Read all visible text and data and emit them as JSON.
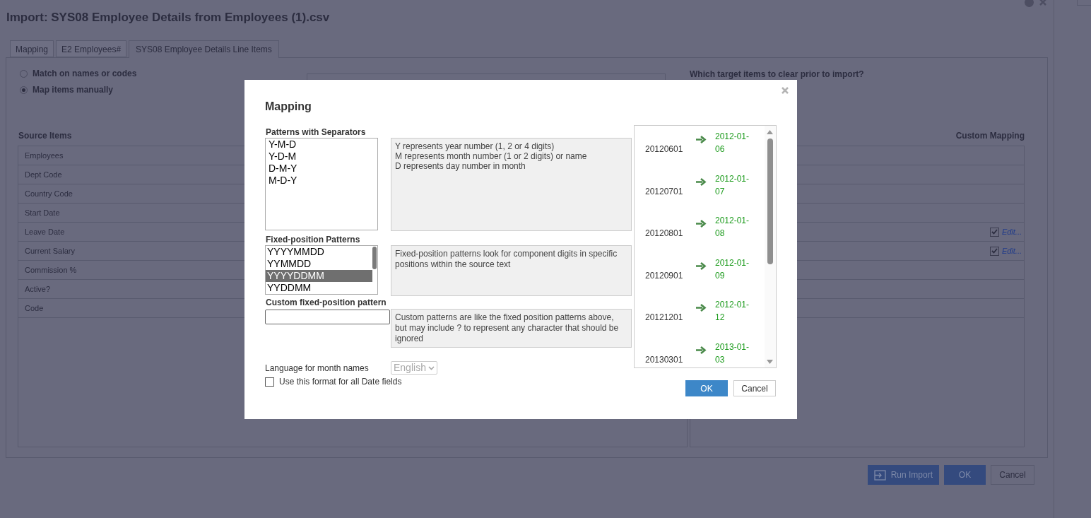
{
  "window": {
    "title": "Import: SYS08 Employee Details from Employees (1).csv"
  },
  "tabs": [
    {
      "label": "Mapping",
      "selected": false
    },
    {
      "label": "E2 Employees#",
      "selected": false
    },
    {
      "label": "SYS08 Employee Details Line Items",
      "selected": true
    }
  ],
  "match_options": [
    {
      "label": "Match on names or codes",
      "selected": false
    },
    {
      "label": "Map items manually",
      "selected": true
    }
  ],
  "clear_prompt": "Which target items to clear prior to import?",
  "source_items": {
    "header": "Source Items",
    "rows": [
      "Employees",
      "Dept Code",
      "Country Code",
      "Start Date",
      "Leave Date",
      "Current Salary",
      "Commission %",
      "Active?",
      "Code"
    ]
  },
  "custom_mapping": {
    "header": "Custom Mapping",
    "rows": [
      {
        "kind": "blank"
      },
      {
        "kind": "blank"
      },
      {
        "kind": "blank"
      },
      {
        "kind": "blank"
      },
      {
        "kind": "format",
        "checked": true,
        "link": "Edit..."
      },
      {
        "kind": "format",
        "checked": true,
        "link": "Edit..."
      },
      {
        "kind": "blank"
      },
      {
        "kind": "blank"
      },
      {
        "kind": "blank"
      }
    ]
  },
  "buttons": [
    {
      "kind": "run",
      "label": "Run Import"
    },
    {
      "kind": "primary",
      "label": "OK"
    },
    {
      "kind": "plain",
      "label": "Cancel"
    }
  ],
  "dialog": {
    "title": "Mapping",
    "separator_patterns": {
      "label": "Patterns with Separators",
      "items": [
        {
          "label": "Y-M-D",
          "selected": false
        },
        {
          "label": "Y-D-M",
          "selected": false
        },
        {
          "label": "D-M-Y",
          "selected": false
        },
        {
          "label": "M-D-Y",
          "selected": false
        }
      ]
    },
    "separator_help": [
      "Y represents year number (1, 2 or 4 digits)",
      "M represents month number (1 or 2 digits) or name",
      "D represents day number in month"
    ],
    "fixed_patterns": {
      "label": "Fixed-position Patterns",
      "items": [
        {
          "label": "YYYYMMDD",
          "selected": false
        },
        {
          "label": "YYMMDD",
          "selected": false
        },
        {
          "label": "YYYYDDMM",
          "selected": true
        },
        {
          "label": "YYDDMM",
          "selected": false
        }
      ]
    },
    "fixed_help": "Fixed-position patterns look for component digits in specific positions within the source text",
    "custom_pattern": {
      "label": "Custom fixed-position pattern"
    },
    "custom_help": "Custom patterns are like the fixed position patterns above, but may include ? to represent any character that should be ignored",
    "language": {
      "label": "Language for month names",
      "value": "English",
      "disabled": true
    },
    "all_dates": {
      "label": "Use this format for all Date fields",
      "checked": false
    },
    "preview": [
      {
        "source": "20120601",
        "result": "2012-01-06"
      },
      {
        "source": "20120701",
        "result": "2012-01-07"
      },
      {
        "source": "20120801",
        "result": "2012-01-08"
      },
      {
        "source": "20120901",
        "result": "2012-01-09"
      },
      {
        "source": "20121201",
        "result": "2012-01-12"
      },
      {
        "source": "20130301",
        "result": "2013-01-03"
      }
    ],
    "buttons": [
      {
        "kind": "primary",
        "label": "OK"
      },
      {
        "kind": "plain",
        "label": "Cancel"
      }
    ]
  }
}
